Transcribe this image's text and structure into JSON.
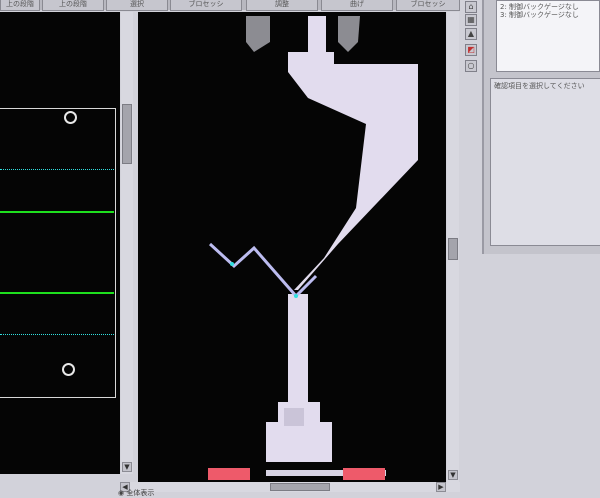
{
  "toolbar": {
    "buttons": [
      "上の段階",
      "上の段階",
      "選択",
      "ブロセッシ",
      "調整",
      "曲げ",
      "ブロセッシ"
    ]
  },
  "right_panel": {
    "list_items": [
      "2: 制御バックゲージなし",
      "3: 制御バックゲージなし"
    ],
    "hint_text": "確認項目を選択してください"
  },
  "status": {
    "option_label": "◉ 全体表示"
  },
  "colors": {
    "canvas": "#050505",
    "tooling": "#e2dcee",
    "sheet": "#bcbcf0",
    "grid_green": "#1ee01e",
    "grid_dotted": "#30e0e0",
    "marker_red": "#ee5a6a"
  },
  "icons": [
    "scroll-up-arrow-icon",
    "scroll-down-arrow-icon",
    "scroll-left-arrow-icon",
    "scroll-right-arrow-icon",
    "circle-marker-icon"
  ]
}
